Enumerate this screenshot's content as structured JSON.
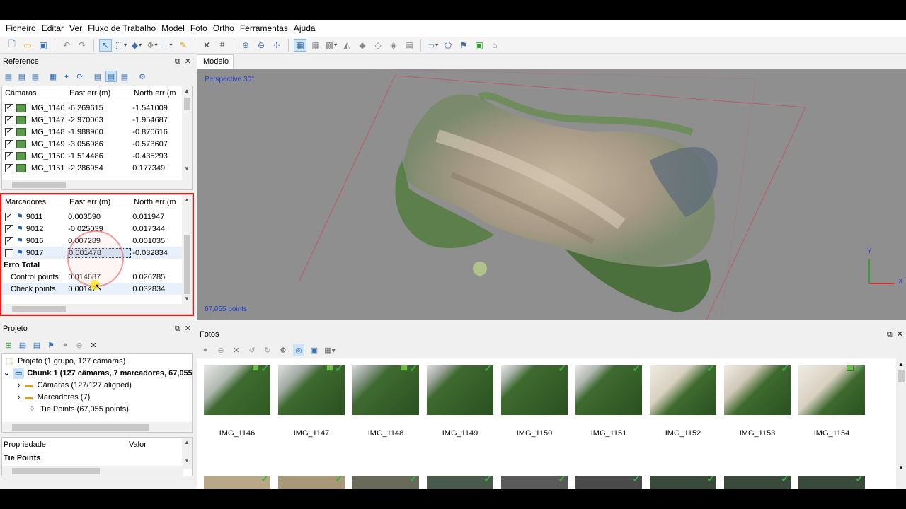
{
  "menu": [
    "Ficheiro",
    "Editar",
    "Ver",
    "Fluxo de Trabalho",
    "Model",
    "Foto",
    "Ortho",
    "Ferramentas",
    "Ajuda"
  ],
  "reference_panel": {
    "title": "Reference",
    "cameras_table": {
      "headers": [
        "Câmaras",
        "East err (m)",
        "North err (m"
      ],
      "rows": [
        {
          "name": "IMG_1146",
          "east": "-6.269615",
          "north": "-1.541009",
          "checked": true
        },
        {
          "name": "IMG_1147",
          "east": "-2.970063",
          "north": "-1.954687",
          "checked": true
        },
        {
          "name": "IMG_1148",
          "east": "-1.988960",
          "north": "-0.870616",
          "checked": true
        },
        {
          "name": "IMG_1149",
          "east": "-3.056986",
          "north": "-0.573607",
          "checked": true
        },
        {
          "name": "IMG_1150",
          "east": "-1.514486",
          "north": "-0.435293",
          "checked": true
        },
        {
          "name": "IMG_1151",
          "east": "-2.286954",
          "north": "0.177349",
          "checked": true
        }
      ]
    },
    "markers_table": {
      "headers": [
        "Marcadores",
        "East err (m)",
        "North err (m"
      ],
      "rows": [
        {
          "name": "9011",
          "east": "0.003590",
          "north": "0.011947",
          "checked": true
        },
        {
          "name": "9012",
          "east": "-0.025039",
          "north": "0.017344",
          "checked": true
        },
        {
          "name": "9016",
          "east": "0.007289",
          "north": "0.001035",
          "checked": true
        },
        {
          "name": "9017",
          "east": "0.001478",
          "north": "-0.032834",
          "checked": false
        }
      ],
      "total_label": "Erro Total",
      "totals": [
        {
          "name": "Control points",
          "east": "0.014687",
          "north": "0.026285"
        },
        {
          "name": "Check points",
          "east": "0.00147",
          "north": "0.032834"
        }
      ]
    }
  },
  "viewport": {
    "tab": "Modelo",
    "perspective": "Perspective 30°",
    "points": "67,055 points",
    "axis_y": "Y",
    "axis_x": "X"
  },
  "project_panel": {
    "title": "Projeto",
    "tree": [
      {
        "label": "Projeto (1 grupo, 127 câmaras)",
        "bold": false
      },
      {
        "label": "Chunk 1 (127 câmaras, 7 marcadores, 67,055",
        "bold": true
      },
      {
        "label": "Câmaras (127/127 aligned)",
        "bold": false
      },
      {
        "label": "Marcadores (7)",
        "bold": false
      },
      {
        "label": "Tie Points (67,055 points)",
        "bold": false
      }
    ]
  },
  "properties_panel": {
    "headers": [
      "Propriedade",
      "Valor"
    ],
    "row": "Tie Points"
  },
  "photos_panel": {
    "title": "Fotos",
    "photos": [
      "IMG_1146",
      "IMG_1147",
      "IMG_1148",
      "IMG_1149",
      "IMG_1150",
      "IMG_1151",
      "IMG_1152",
      "IMG_1153",
      "IMG_1154"
    ]
  },
  "colors": {
    "highlight": "#e02020",
    "check": "#3cb043",
    "selection": "#cce4f7"
  }
}
